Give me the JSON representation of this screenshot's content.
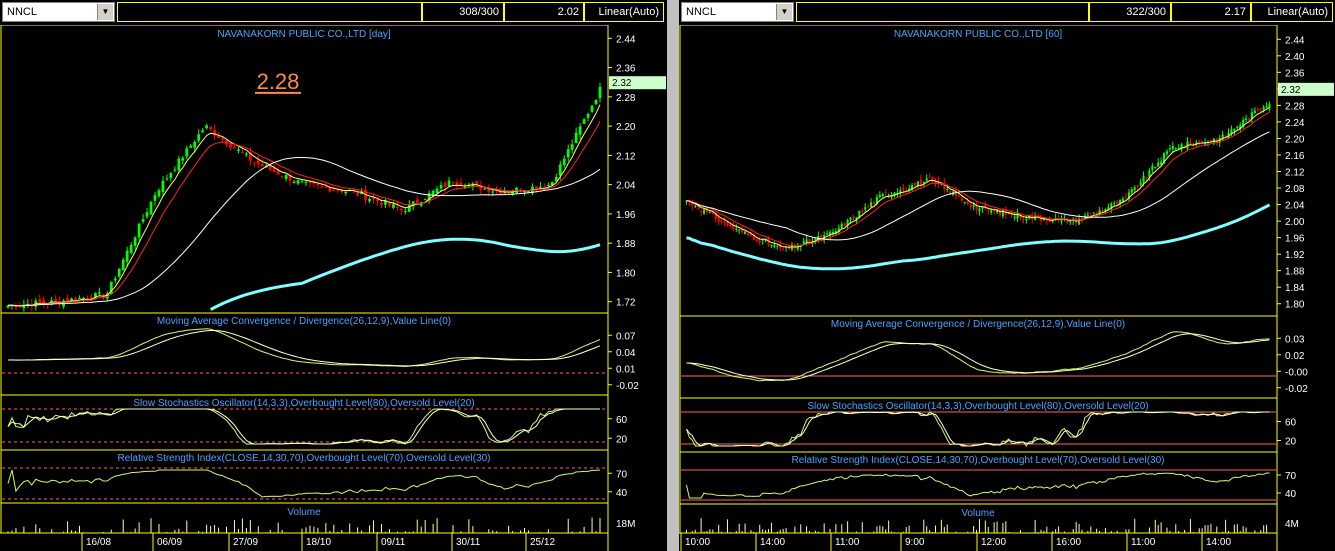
{
  "left": {
    "symbol": "NNCL",
    "count": "308/300",
    "value": "2.02",
    "scale": "Linear(Auto)",
    "title": "NAVANAKORN PUBLIC CO.,LTD [day]",
    "annotation": "2.28",
    "last_price": "2.32",
    "price_ticks": [
      "2.44",
      "2.36",
      "2.28",
      "2.20",
      "2.12",
      "2.04",
      "1.96",
      "1.88",
      "1.80",
      "1.72"
    ],
    "macd_label": "Moving Average Convergence / Divergence(26,12,9),Value Line(0)",
    "macd_ticks": [
      "0.07",
      "0.04",
      "0.01",
      "-0.02"
    ],
    "stoch_label": "Slow Stochastics Oscillator(14,3,3),Overbought Level(80),Oversold Level(20)",
    "stoch_ticks": [
      "60",
      "20"
    ],
    "rsi_label": "Relative Strength Index(CLOSE,14,30,70),Overbought Level(70),Oversold Level(30)",
    "rsi_ticks": [
      "70",
      "40"
    ],
    "volume_label": "Volume",
    "volume_tick": "18M",
    "x_labels": [
      "16/08",
      "06/09",
      "27/09",
      "18/10",
      "09/11",
      "30/11",
      "25/12"
    ]
  },
  "right": {
    "symbol": "NNCL",
    "count": "322/300",
    "value": "2.17",
    "scale": "Linear(Auto)",
    "title": "NAVANAKORN PUBLIC CO.,LTD [60]",
    "last_price": "2.32",
    "price_ticks": [
      "2.44",
      "2.40",
      "2.36",
      "2.32",
      "2.28",
      "2.24",
      "2.20",
      "2.16",
      "2.12",
      "2.08",
      "2.04",
      "2.00",
      "1.96",
      "1.92",
      "1.88",
      "1.84",
      "1.80"
    ],
    "macd_label": "Moving Average Convergence / Divergence(26,12,9),Value Line(0)",
    "macd_ticks": [
      "0.03",
      "0.02",
      "-0.00",
      "-0.02"
    ],
    "stoch_label": "Slow Stochastics Oscillator(14,3,3),Overbought Level(80),Oversold Level(20)",
    "stoch_ticks": [
      "60",
      "20"
    ],
    "rsi_label": "Relative Strength Index(CLOSE,14,30,70),Overbought Level(70),Oversold Level(30)",
    "rsi_ticks": [
      "70",
      "40"
    ],
    "volume_label": "Volume",
    "volume_tick": "4M",
    "x_labels": [
      "10:00",
      "14:00",
      "11:00",
      "9:00",
      "12:00",
      "16:00",
      "11:00",
      "14:00"
    ]
  },
  "colors": {
    "up": "#00ff00",
    "down": "#ff0000",
    "grid": "#ffff00",
    "label": "#4aa3ff",
    "ma_fast": "#ffff66",
    "ma_mid": "#ff2020",
    "ma_slow": "#ffffff",
    "ma_long": "#7fffff",
    "annotation": "#ff8c40",
    "price_tag": "#ccffcc"
  },
  "chart_data": [
    {
      "type": "line",
      "title": "NAVANAKORN PUBLIC CO.,LTD [day]",
      "ylim": [
        1.7,
        2.46
      ],
      "x": [
        "16/08",
        "06/09",
        "27/09",
        "18/10",
        "09/11",
        "30/11",
        "25/12"
      ],
      "series": [
        {
          "values": [
            1.71,
            1.72,
            1.74,
            2.02,
            2.2,
            2.1,
            2.04,
            2.02,
            1.97,
            2.05,
            2.02,
            2.04,
            2.3
          ]
        }
      ]
    },
    {
      "type": "line",
      "title": "NAVANAKORN PUBLIC CO.,LTD [60]",
      "ylim": [
        1.78,
        2.46
      ],
      "x": [
        "10:00",
        "14:00",
        "11:00",
        "9:00",
        "12:00",
        "16:00",
        "11:00",
        "14:00"
      ],
      "series": [
        {
          "values": [
            2.05,
            1.98,
            1.93,
            1.97,
            2.06,
            2.1,
            2.03,
            2.01,
            2.0,
            2.05,
            2.18,
            2.2,
            2.29
          ]
        }
      ]
    }
  ]
}
